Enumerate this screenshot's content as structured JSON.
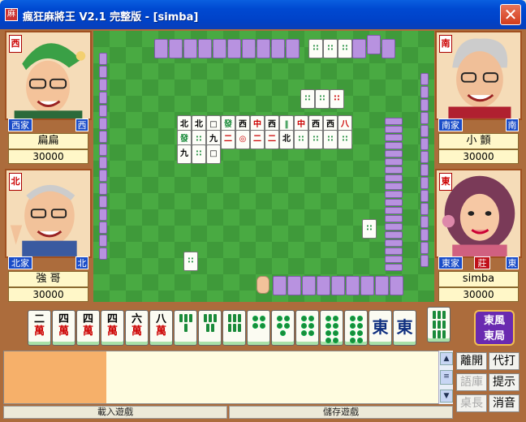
{
  "window": {
    "title": "瘋狂麻將王 V2.1 完整版 - [simba]",
    "close_label": "✕"
  },
  "players": {
    "west": {
      "seat_badge": "西",
      "wind_tag": "西家",
      "wind": "西",
      "name": "扁扁",
      "score": "30000"
    },
    "south": {
      "seat_badge": "南",
      "wind_tag": "南家",
      "wind": "南",
      "name": "小 顫",
      "score": "30000"
    },
    "north": {
      "seat_badge": "北",
      "wind_tag": "北家",
      "wind": "北",
      "name": "強 哥",
      "score": "30000"
    },
    "east": {
      "seat_badge": "東",
      "wind_tag": "東家",
      "wind": "東",
      "dealer": "莊",
      "name": "simba",
      "score": "30000"
    }
  },
  "discards": {
    "row1": [
      "北",
      "北",
      "□",
      "發",
      "西",
      "中",
      "西",
      "‖",
      "中",
      "西",
      "西",
      "八"
    ],
    "row2": [
      "發",
      "∷",
      "九",
      "二",
      "◎",
      "二",
      "二",
      "北",
      "∷",
      "∷",
      "∷",
      "∷"
    ],
    "row3": [
      "九",
      "∷",
      "□"
    ]
  },
  "hand": {
    "tiles": [
      {
        "type": "wan",
        "num": "二",
        "suit": "萬"
      },
      {
        "type": "wan",
        "num": "四",
        "suit": "萬"
      },
      {
        "type": "wan",
        "num": "四",
        "suit": "萬"
      },
      {
        "type": "wan",
        "num": "四",
        "suit": "萬"
      },
      {
        "type": "wan",
        "num": "六",
        "suit": "萬"
      },
      {
        "type": "wan",
        "num": "八",
        "suit": "萬"
      },
      {
        "type": "bamboo",
        "count": 4
      },
      {
        "type": "bamboo",
        "count": 5
      },
      {
        "type": "bamboo",
        "count": 6
      },
      {
        "type": "circ",
        "count": 4
      },
      {
        "type": "circ",
        "count": 5
      },
      {
        "type": "circ",
        "count": 6
      },
      {
        "type": "circ",
        "count": 8
      },
      {
        "type": "circ",
        "count": 8
      },
      {
        "type": "honor",
        "char": "東"
      },
      {
        "type": "honor",
        "char": "東"
      }
    ],
    "drawn": {
      "type": "bamboo",
      "count": 9
    }
  },
  "round": {
    "line1": "東風",
    "line2": "東局"
  },
  "controls": {
    "leave": "離開",
    "auto_play": "代打",
    "phrases": "語庫",
    "hint": "提示",
    "table_lead": "桌長",
    "mute": "消音"
  },
  "status": {
    "load_game": "載入遊戲",
    "save_game": "儲存遊戲"
  },
  "colors": {
    "felt": "#3f9a3a",
    "tile_back": "#b892e0",
    "frame": "#ac6c3c",
    "title_bar": "#0049d1"
  }
}
